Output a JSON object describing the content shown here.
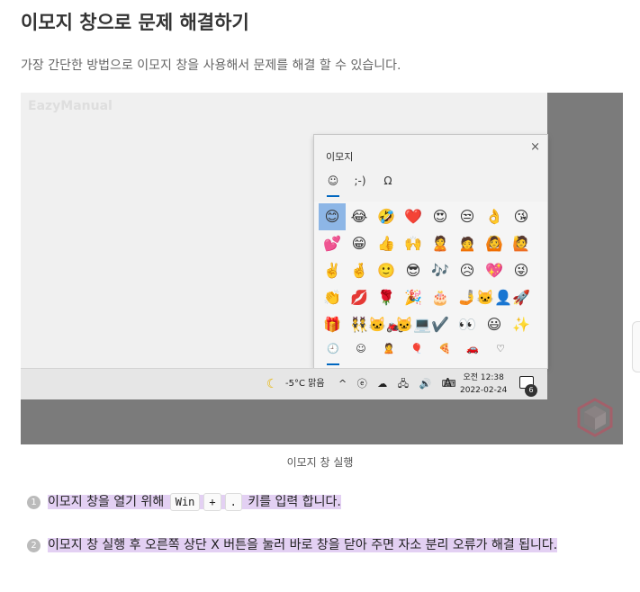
{
  "article": {
    "title": "이모지 창으로 문제 해결하기",
    "intro": "가장 간단한 방법으로 이모지 창을 사용해서 문제를 해결 할 수 있습니다.",
    "caption": "이모지 창 실행"
  },
  "screenshot": {
    "watermark": "EazyManual",
    "emoji_panel": {
      "title": "이모지",
      "close_glyph": "×",
      "category_tabs": [
        "☺",
        ";-)",
        "Ω"
      ],
      "rows": [
        [
          "😊",
          "😂",
          "🤣",
          "❤️",
          "😍",
          "😒",
          "👌",
          "😘"
        ],
        [
          "💕",
          "😁",
          "👍",
          "🙌",
          "🙎",
          "🙍",
          "🙆",
          "🙋"
        ],
        [
          "✌️",
          "🤞",
          "🙂",
          "😎",
          "🎶",
          "😥",
          "💖",
          "😜"
        ],
        [
          "👏",
          "💋",
          "🌹",
          "🎉",
          "🎂",
          "🤳",
          "🐱‍👤",
          "🚀"
        ],
        [
          "🎁",
          "👯",
          "🐱‍🏍",
          "🐱‍💻",
          "✔️",
          "👀",
          "😃",
          "✨"
        ]
      ],
      "selected_index": 0,
      "bottom_categories": [
        "🕘",
        "☺",
        "🙎",
        "🎈",
        "🍕",
        "🚗",
        "♡"
      ]
    },
    "taskbar": {
      "weather_icon": "moon-icon",
      "weather": "-5°C  맑음",
      "tray_icons": "^ ⓔ ☁ 🖧 🔊 ⌨",
      "ime": "A",
      "time": "오전 12:38",
      "date": "2022-02-24",
      "notification_count": "6"
    }
  },
  "steps": {
    "step1": {
      "number": "1",
      "before": "이모지 창을 열기 위해",
      "key1": "Win",
      "plus": "+",
      "key2": ".",
      "after": "키를 입력 합니다."
    },
    "step2": {
      "number": "2",
      "text": "이모지 창 실행 후 오른쪽 상단 X 버튼을 눌러 바로 창을 닫아 주면 자소 분리 오류가 해결 됩니다."
    }
  },
  "colors": {
    "highlight": "#e3d0f3",
    "accent": "#0067c0",
    "selected": "#8db6e6"
  }
}
